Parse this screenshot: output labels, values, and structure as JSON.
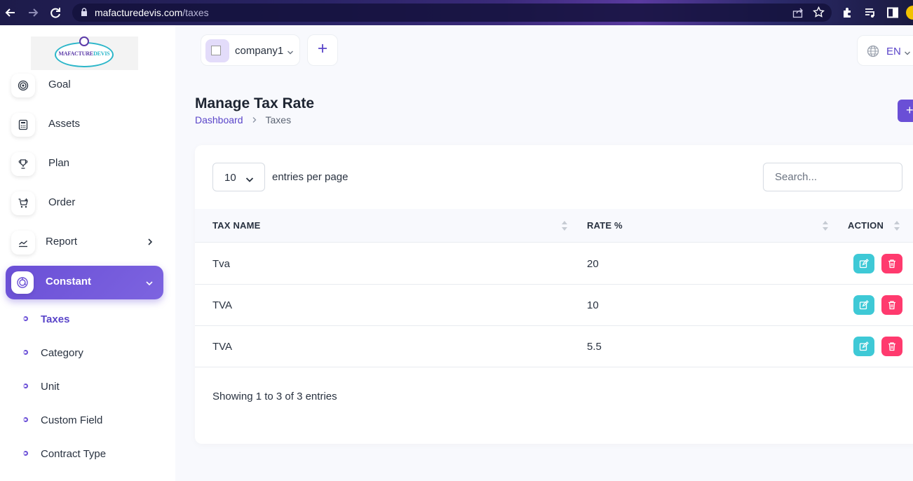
{
  "browser": {
    "url_host": "mafacturedevis.com",
    "url_path": "/taxes"
  },
  "logo": {
    "text_part1": "MAFACTURE",
    "text_part2": "DEVIS"
  },
  "sidebar": {
    "items": [
      {
        "label": "Goal",
        "icon": "target-icon"
      },
      {
        "label": "Assets",
        "icon": "calculator-icon"
      },
      {
        "label": "Plan",
        "icon": "trophy-icon"
      },
      {
        "label": "Order",
        "icon": "cart-icon"
      },
      {
        "label": "Report",
        "icon": "chart-line-icon"
      },
      {
        "label": "Constant",
        "icon": "chart-donut-icon"
      }
    ],
    "sub_items": [
      {
        "label": "Taxes"
      },
      {
        "label": "Category"
      },
      {
        "label": "Unit"
      },
      {
        "label": "Custom Field"
      },
      {
        "label": "Contract Type"
      }
    ]
  },
  "topbar": {
    "company_name": "company1",
    "language": "EN"
  },
  "page": {
    "title": "Manage Tax Rate",
    "breadcrumb": [
      "Dashboard",
      "Taxes"
    ],
    "create_label": "+"
  },
  "table": {
    "per_page_value": "10",
    "per_page_label": "entries per page",
    "search_placeholder": "Search...",
    "columns": [
      "TAX NAME",
      "RATE %",
      "ACTION"
    ],
    "rows": [
      {
        "name": "Tva",
        "rate": "20"
      },
      {
        "name": "TVA",
        "rate": "10"
      },
      {
        "name": "TVA",
        "rate": "5.5"
      }
    ],
    "footer": "Showing 1 to 3 of 3 entries"
  },
  "colors": {
    "primary": "#6a4fd6",
    "edit": "#3ec9d6",
    "delete": "#ff3a6e"
  }
}
